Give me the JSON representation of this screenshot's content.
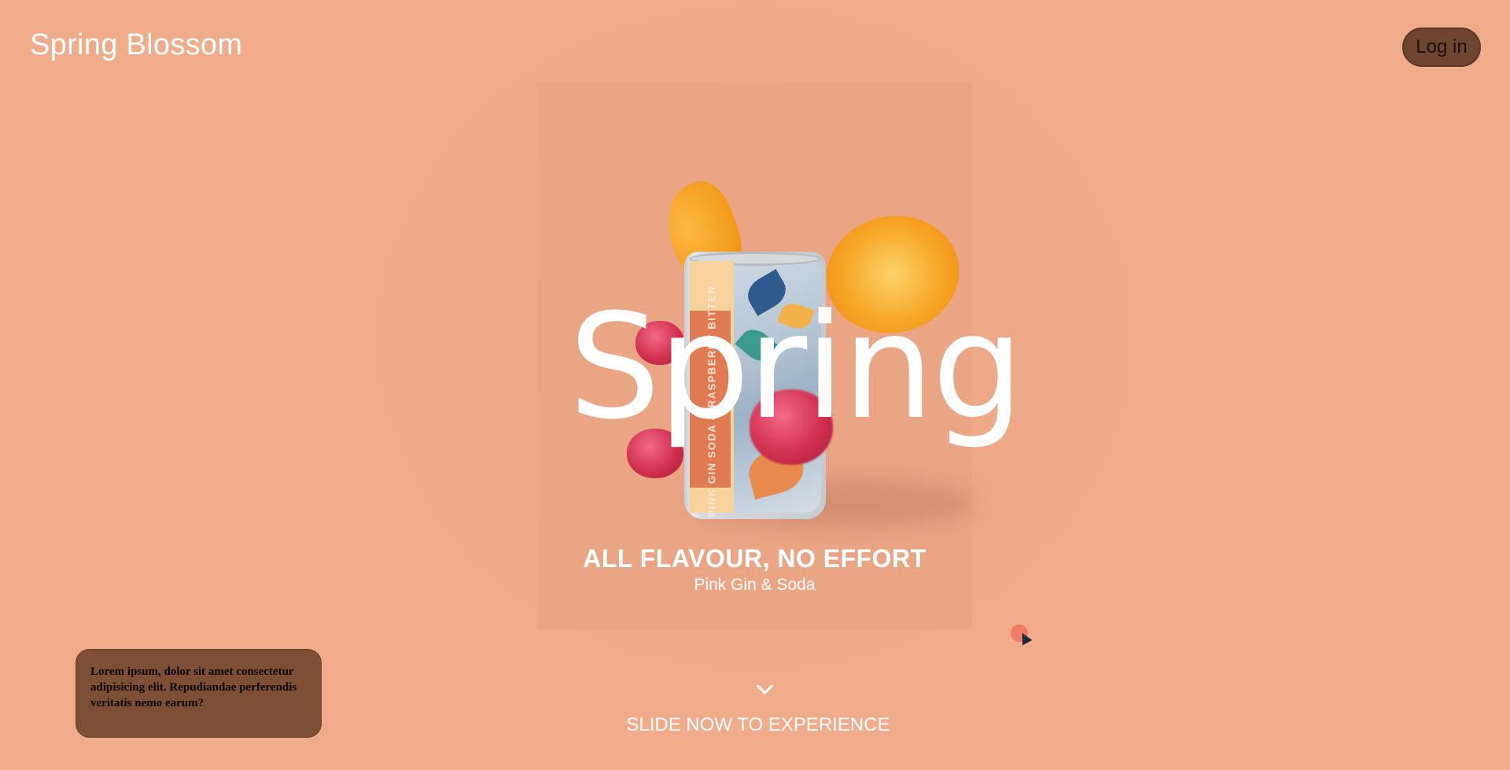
{
  "header": {
    "brand": "Spring Blossom",
    "login_label": "Log in"
  },
  "hero": {
    "big_word": "Spring",
    "can_label": "PINK GIN SODA & RASPBERRY BITTER",
    "headline": "ALL FLAVOUR, NO EFFORT",
    "subline": "Pink Gin & Soda"
  },
  "cta": {
    "icon": "chevron-down-icon",
    "label": "SLIDE NOW TO EXPERIENCE"
  },
  "note": {
    "text": "Lorem ipsum, dolor sit amet consectetur adipisicing elit. Repudiandae perferendis veritatis nemo earum?"
  },
  "colors": {
    "background": "#efab8a",
    "button": "#6e4432",
    "note_bg": "#7d4f37",
    "cursor_dot": "#f07c64"
  }
}
